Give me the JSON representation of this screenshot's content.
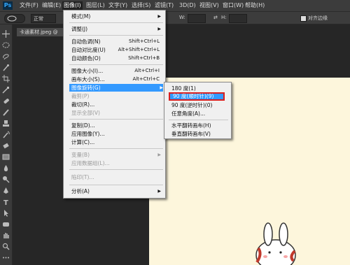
{
  "app": {
    "logo": "Ps"
  },
  "menubar": {
    "items": [
      {
        "label": "文件(F)",
        "active": false
      },
      {
        "label": "编辑(E)",
        "active": false
      },
      {
        "label": "图像(I)",
        "active": true
      },
      {
        "label": "图层(L)",
        "active": false
      },
      {
        "label": "文字(Y)",
        "active": false
      },
      {
        "label": "选择(S)",
        "active": false
      },
      {
        "label": "滤镜(T)",
        "active": false
      },
      {
        "label": "3D(D)",
        "active": false
      },
      {
        "label": "视图(V)",
        "active": false
      },
      {
        "label": "窗口(W)",
        "active": false
      },
      {
        "label": "帮助(H)",
        "active": false
      }
    ]
  },
  "options_bar": {
    "style_value": "正常",
    "width_label": "W:",
    "height_label": "H:",
    "align_label": "对齐边缘"
  },
  "document": {
    "tab_label": "卡通素材.jpeg @"
  },
  "image_menu": {
    "items": [
      {
        "label": "模式(M)",
        "shortcut": "",
        "submenu": true,
        "disabled": false
      },
      {
        "sep": true
      },
      {
        "label": "调整(J)",
        "shortcut": "",
        "submenu": true,
        "disabled": false
      },
      {
        "sep": true
      },
      {
        "label": "自动色调(N)",
        "shortcut": "Shift+Ctrl+L",
        "disabled": false
      },
      {
        "label": "自动对比度(U)",
        "shortcut": "Alt+Shift+Ctrl+L",
        "disabled": false
      },
      {
        "label": "自动颜色(O)",
        "shortcut": "Shift+Ctrl+B",
        "disabled": false
      },
      {
        "sep": true
      },
      {
        "label": "图像大小(I)...",
        "shortcut": "Alt+Ctrl+I",
        "disabled": false
      },
      {
        "label": "画布大小(S)...",
        "shortcut": "Alt+Ctrl+C",
        "disabled": false
      },
      {
        "label": "图像旋转(G)",
        "shortcut": "",
        "submenu": true,
        "highlighted": true,
        "disabled": false
      },
      {
        "label": "裁剪(P)",
        "shortcut": "",
        "disabled": true
      },
      {
        "label": "裁切(R)...",
        "shortcut": "",
        "disabled": false
      },
      {
        "label": "显示全部(V)",
        "shortcut": "",
        "disabled": true
      },
      {
        "sep": true
      },
      {
        "label": "复制(D)...",
        "shortcut": "",
        "disabled": false
      },
      {
        "label": "应用图像(Y)...",
        "shortcut": "",
        "disabled": false
      },
      {
        "label": "计算(C)...",
        "shortcut": "",
        "disabled": false
      },
      {
        "sep": true
      },
      {
        "label": "变量(B)",
        "shortcut": "",
        "submenu": true,
        "disabled": true
      },
      {
        "label": "应用数据组(L)...",
        "shortcut": "",
        "disabled": true
      },
      {
        "sep": true
      },
      {
        "label": "陷印(T)...",
        "shortcut": "",
        "disabled": true
      },
      {
        "sep": true
      },
      {
        "label": "分析(A)",
        "shortcut": "",
        "submenu": true,
        "disabled": false
      }
    ]
  },
  "rotate_submenu": {
    "items": [
      {
        "label": "180 度(1)",
        "highlighted": false
      },
      {
        "label": "90 度(顺时针)(9)",
        "highlighted": true
      },
      {
        "label": "90 度(逆时针)(0)",
        "highlighted": false
      },
      {
        "label": "任意角度(A)...",
        "highlighted": false
      },
      {
        "sep": true
      },
      {
        "label": "水平翻转画布(H)",
        "highlighted": false
      },
      {
        "label": "垂直翻转画布(V)",
        "highlighted": false
      }
    ]
  },
  "colors": {
    "highlight": "#3399ff",
    "callout": "#d81e1e",
    "canvas": "#fdf6dc"
  }
}
